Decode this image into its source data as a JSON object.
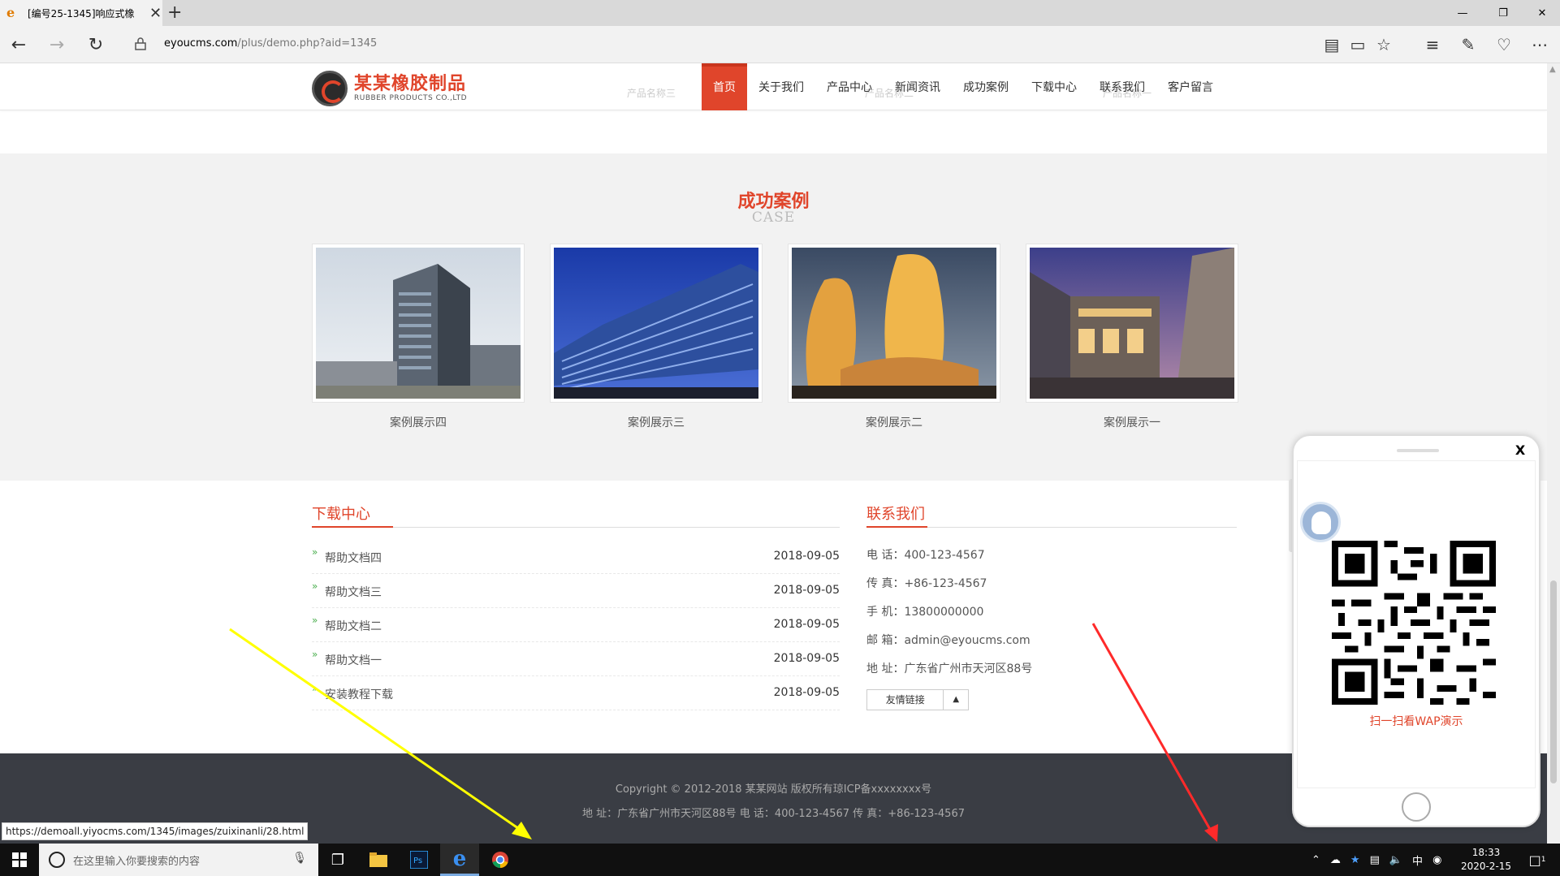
{
  "browser": {
    "tab_title": "[编号25-1345]响应式橡",
    "tab_close": "✕",
    "new_tab": "+",
    "url_host": "eyoucms.com",
    "url_path": "/plus/demo.php?aid=1345",
    "status_url": "https://demoall.yiyocms.com/1345/images/zuixinanli/28.html"
  },
  "site": {
    "logo_cn": "某某橡胶制品",
    "logo_en": "RUBBER PRODUCTS CO.,LTD",
    "nav": [
      "首页",
      "关于我们",
      "产品中心",
      "新闻资讯",
      "成功案例",
      "下载中心",
      "联系我们",
      "客户留言"
    ],
    "ghost_labels": [
      "产品名称三",
      "产品名称二",
      "产品名称一"
    ]
  },
  "cases": {
    "title": "成功案例",
    "subtitle": "CASE",
    "items": [
      {
        "caption": "案例展示四"
      },
      {
        "caption": "案例展示三"
      },
      {
        "caption": "案例展示二"
      },
      {
        "caption": "案例展示一"
      }
    ]
  },
  "downloads": {
    "title": "下载中心",
    "items": [
      {
        "name": "帮助文档四",
        "date": "2018-09-05"
      },
      {
        "name": "帮助文档三",
        "date": "2018-09-05"
      },
      {
        "name": "帮助文档二",
        "date": "2018-09-05"
      },
      {
        "name": "帮助文档一",
        "date": "2018-09-05"
      },
      {
        "name": "安装教程下载",
        "date": "2018-09-05"
      }
    ]
  },
  "contact": {
    "title": "联系我们",
    "phone": "电 话：400-123-4567",
    "fax": "传 真：+86-123-4567",
    "mobile": "手 机：13800000000",
    "email": "邮 箱：admin@eyoucms.com",
    "address": "地 址：广东省广州市天河区88号",
    "friend_links": "友情链接"
  },
  "footer": {
    "copyright": "Copyright © 2012-2018 某某网站 版权所有琼ICP备xxxxxxxx号",
    "info": "地 址：广东省广州市天河区88号 电 话：400-123-4567 传 真：+86-123-4567"
  },
  "popup": {
    "close": "X",
    "qr_caption": "扫一扫看WAP演示"
  },
  "taskbar": {
    "search_placeholder": "在这里输入你要搜索的内容",
    "ime": "中",
    "time": "18:33",
    "date": "2020-2-15",
    "notif_count": "1"
  },
  "colors": {
    "brand": "#e0452b",
    "footer_bg": "#3a3d44",
    "case_bg": "#f2f2f2",
    "annotation_yellow": "#ffff00",
    "annotation_red": "#ff2a2a"
  }
}
